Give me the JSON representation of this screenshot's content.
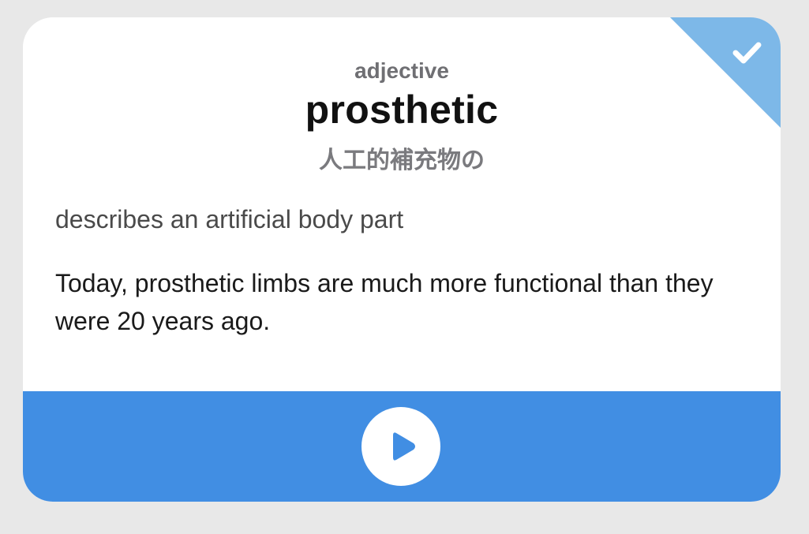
{
  "card": {
    "part_of_speech": "adjective",
    "word": "prosthetic",
    "translation": "人工的補充物の",
    "definition": "describes an artificial body part",
    "example": "Today, prosthetic limbs are much more functional than they were 20 years ago."
  },
  "status": {
    "icon": "checkmark-icon",
    "color": "#7db8e8"
  },
  "audio": {
    "icon": "play-icon",
    "bar_color": "#418ee3"
  }
}
